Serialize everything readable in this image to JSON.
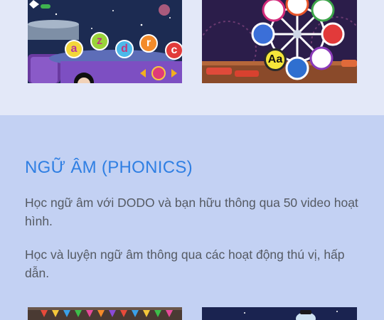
{
  "section": {
    "title": "NGỮ ÂM (PHONICS)",
    "paragraphs": [
      "Học ngữ âm với DODO và bạn hữu thông qua 50 video hoạt hình.",
      "Học và luyện ngữ âm thông qua các hoạt động thú vị, hấp dẫn."
    ]
  },
  "game_letters": [
    "a",
    "z",
    "d",
    "r",
    "c"
  ],
  "wheel_label": "Aa",
  "colors": {
    "top_band": "#e3e8f8",
    "main_band": "#c3d1f3",
    "title": "#2f7fe3",
    "body_text": "#555a63"
  }
}
